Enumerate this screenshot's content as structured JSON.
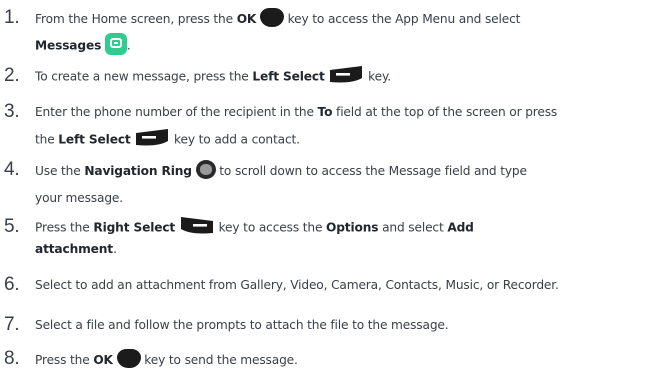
{
  "steps": [
    {
      "number": "1.",
      "lines": [
        [
          "From the Home screen, press the ",
          "OK",
          " key to access the App Menu and  select"
        ],
        [
          "Messages",
          "."
        ]
      ]
    },
    {
      "number": "2.",
      "lines": [
        [
          "To create a new message, press the ",
          "Left Select",
          " key."
        ]
      ]
    },
    {
      "number": "3.",
      "lines": [
        [
          "Enter the phone number of the recipient in the ",
          "To",
          " field at the top of the screen  or press"
        ],
        [
          "the ",
          "Left Select",
          " key to add a contact."
        ]
      ]
    },
    {
      "number": "4.",
      "lines": [
        [
          "Use the ",
          "Navigation Ring",
          " to scroll down to access the Message field and  type"
        ],
        [
          "your message."
        ]
      ]
    },
    {
      "number": "5.",
      "lines": [
        [
          "Press the ",
          "Right Select",
          " key to access the ",
          "Options",
          " and select ",
          "Add"
        ],
        [
          "attachment",
          "."
        ]
      ]
    },
    {
      "number": "6.",
      "lines": [
        [
          "Select to add an attachment from Gallery, Video, Camera, Contacts, Music, or  Recorder."
        ]
      ]
    },
    {
      "number": "7.",
      "lines": [
        [
          "Select a file and follow the prompts to attach the file to the message."
        ]
      ]
    },
    {
      "number": "8.",
      "lines": [
        [
          "Press the ",
          "OK",
          " key to send the message."
        ]
      ]
    }
  ],
  "icons": {
    "ok_key": "ok-key-icon",
    "messages_app": "messages-app-icon",
    "left_select": "left-select-key-icon",
    "right_select": "right-select-key-icon",
    "navigation_ring": "navigation-ring-icon"
  },
  "colors": {
    "text": "#3a3f47",
    "bold_text": "#22272e",
    "key_black": "#1b1b1b",
    "messages_green": "#2ecc8f"
  }
}
